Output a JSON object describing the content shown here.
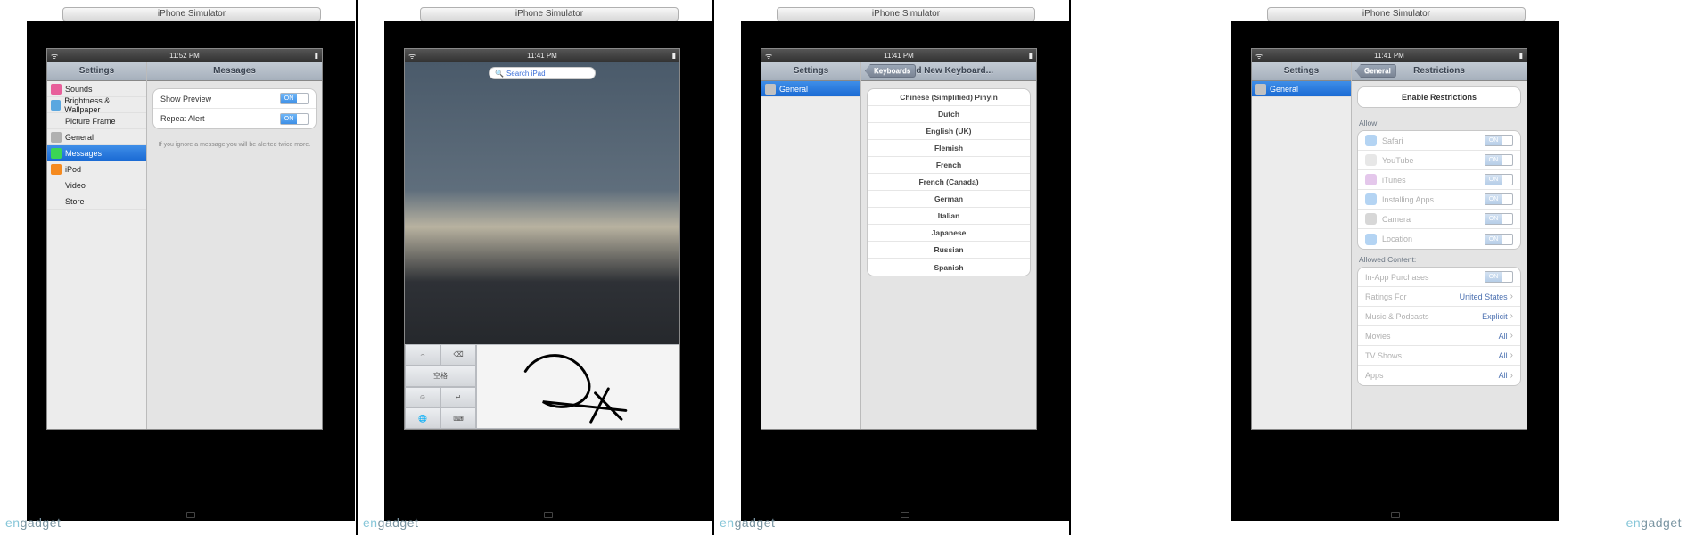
{
  "windowTitle": "iPhone Simulator",
  "logo": "engadget",
  "times": {
    "a": "11:52 PM",
    "b": "11:41 PM"
  },
  "screen1": {
    "sidebarTitle": "Settings",
    "detailTitle": "Messages",
    "sidebar": [
      {
        "label": "Sounds",
        "icon": "sounds",
        "color": "#e85f9a",
        "sel": false
      },
      {
        "label": "Brightness & Wallpaper",
        "icon": "bright",
        "color": "#5aa7e0",
        "sel": false
      },
      {
        "label": "Picture Frame",
        "icon": "frame",
        "color": "",
        "sel": false
      },
      {
        "label": "General",
        "icon": "gear",
        "color": "#b0b0b0",
        "sel": false
      },
      {
        "label": "Messages",
        "icon": "msg",
        "color": "#36c24d",
        "sel": true
      },
      {
        "label": "iPod",
        "icon": "ipod",
        "color": "#f58a1f",
        "sel": false
      },
      {
        "label": "Video",
        "icon": "video",
        "color": "",
        "sel": false
      },
      {
        "label": "Store",
        "icon": "store",
        "color": "",
        "sel": false
      }
    ],
    "rows": [
      {
        "label": "Show Preview"
      },
      {
        "label": "Repeat Alert"
      }
    ],
    "hint": "If you ignore a message you will be alerted twice more."
  },
  "screen2": {
    "searchPlaceholder": "Search iPad",
    "keys": {
      "space": "空格"
    }
  },
  "screen3": {
    "sidebarTitle": "Settings",
    "detailTitle": "Add New Keyboard...",
    "backLabel": "Keyboards",
    "sidebar": [
      {
        "label": "General",
        "icon": "gear",
        "color": "#b0b0b0",
        "sel": true
      }
    ],
    "langs": [
      "Chinese (Simplified) Pinyin",
      "Dutch",
      "English (UK)",
      "Flemish",
      "French",
      "French (Canada)",
      "German",
      "Italian",
      "Japanese",
      "Russian",
      "Spanish"
    ]
  },
  "screen4": {
    "sidebarTitle": "Settings",
    "detailTitle": "Restrictions",
    "backLabel": "General",
    "sidebar": [
      {
        "label": "General",
        "icon": "gear",
        "color": "#b0b0b0",
        "sel": true
      }
    ],
    "enableLabel": "Enable Restrictions",
    "allowLabel": "Allow:",
    "allow": [
      {
        "label": "Safari",
        "icon": "#6aa9e8"
      },
      {
        "label": "YouTube",
        "icon": "#d0d0d0"
      },
      {
        "label": "iTunes",
        "icon": "#c98fd8"
      },
      {
        "label": "Installing Apps",
        "icon": "#6aa9e8"
      },
      {
        "label": "Camera",
        "icon": "#b0b0b0"
      },
      {
        "label": "Location",
        "icon": "#6aa9e8"
      }
    ],
    "contentLabel": "Allowed Content:",
    "content": [
      {
        "label": "In-App Purchases",
        "val": "",
        "switch": true
      },
      {
        "label": "Ratings For",
        "val": "United States"
      },
      {
        "label": "Music & Podcasts",
        "val": "Explicit"
      },
      {
        "label": "Movies",
        "val": "All"
      },
      {
        "label": "TV Shows",
        "val": "All"
      },
      {
        "label": "Apps",
        "val": "All"
      }
    ]
  }
}
